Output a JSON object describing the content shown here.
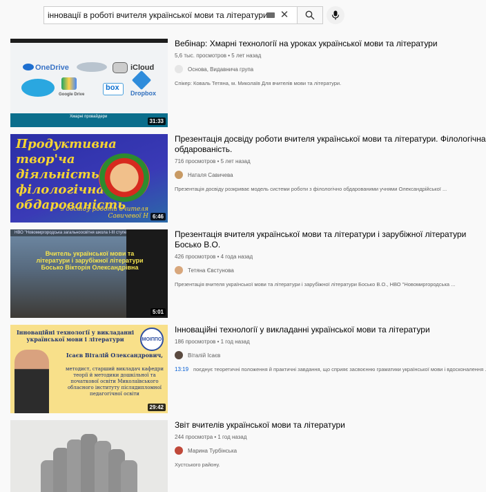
{
  "search": {
    "query": "інновації в роботі вчителя української мови та літератури"
  },
  "icons": {
    "keyboard": "keyboard-icon",
    "clear": "close-icon",
    "search": "search-icon",
    "mic": "microphone-icon",
    "clear_glyph": "✕"
  },
  "results": [
    {
      "title": "Вебінар: Хмарні технології на уроках української мови та літератури",
      "stats": "5,6 тыс. просмотров • 5 лет назад",
      "channel": "Основа, Видавнича група",
      "description": "Спікер: Коваль Тетяна, м. Миколаїв Для вчителів мови та літератури.",
      "duration": "31:33",
      "thumb": {
        "labels": [
          "OneDrive",
          "iCloud",
          "Google Drive",
          "box",
          "Dropbox"
        ],
        "caption": "Хмарні провайдери"
      }
    },
    {
      "title": "Презентація досвіду роботи вчителя української мови та літератури. Філологічна обдарованість.",
      "stats": "716 просмотров • 5 лет назад",
      "channel": "Наталя Савичева",
      "description": "Презентація досвіду розкриває модель системи роботи з філологічно обдарованими учнями Олександрійської ...",
      "duration": "6:46",
      "thumb": {
        "title": "Продуктивна твор'ча діяльність: філологічна обдарованість",
        "sub": "з досвіду роботи вчителя Савичевої Н"
      }
    },
    {
      "title": "Презентація вчителя української мови та літератури і зарубіжної літератури Босько В.О.",
      "stats": "426 просмотров • 4 года назад",
      "channel": "Тетяна Євстунова",
      "description": "Презентація вчителя української мови та літератури і зарубіжної літератури Босько В.О., НВО \"Новомиргородська ...",
      "duration": "5:01",
      "thumb": {
        "header": "НВО \"Новомиргородська загальноосвітня школа І-ІІІ ступенів №3-ДНЗ\"",
        "overlay": "Вчитель української мови та літератури і зарубіжної літератури Босько Вікторія Олександрівна"
      }
    },
    {
      "title": "Інноваційні технології у викладанні української мови та літератури",
      "stats": "186 просмотров • 1 год назад",
      "channel": "Віталій Ісаєв",
      "timestamp": "13:19",
      "description": "поєднує теоретичні положення й практичні завдання, що сприяє засвоєнню граматики української мови і вдосконалення ...",
      "duration": "29:42",
      "thumb": {
        "header": "Інноваційні технології у викладанні української мови і літератури",
        "logo": "МОІППО",
        "name": "Ісаєв Віталій Олександрович,",
        "body": "методист, старший викладач кафедри теорії й методики дошкільної та початкової освіти Миколаївського обласного інституту післядипломної педагогічної освіти"
      }
    },
    {
      "title": "Звіт вчителів української мови та літератури",
      "stats": "244 просмотра • 1 год назад",
      "channel": "Марина Турбінська",
      "description": "Хустського району.",
      "duration": ""
    }
  ],
  "colors": {
    "avatar_1": "#e6e6e6",
    "avatar_2": "#c89a64",
    "avatar_3": "#d8a77c",
    "avatar_4": "#5a4a40",
    "avatar_5": "#c0493a",
    "link": "#065fd4"
  }
}
